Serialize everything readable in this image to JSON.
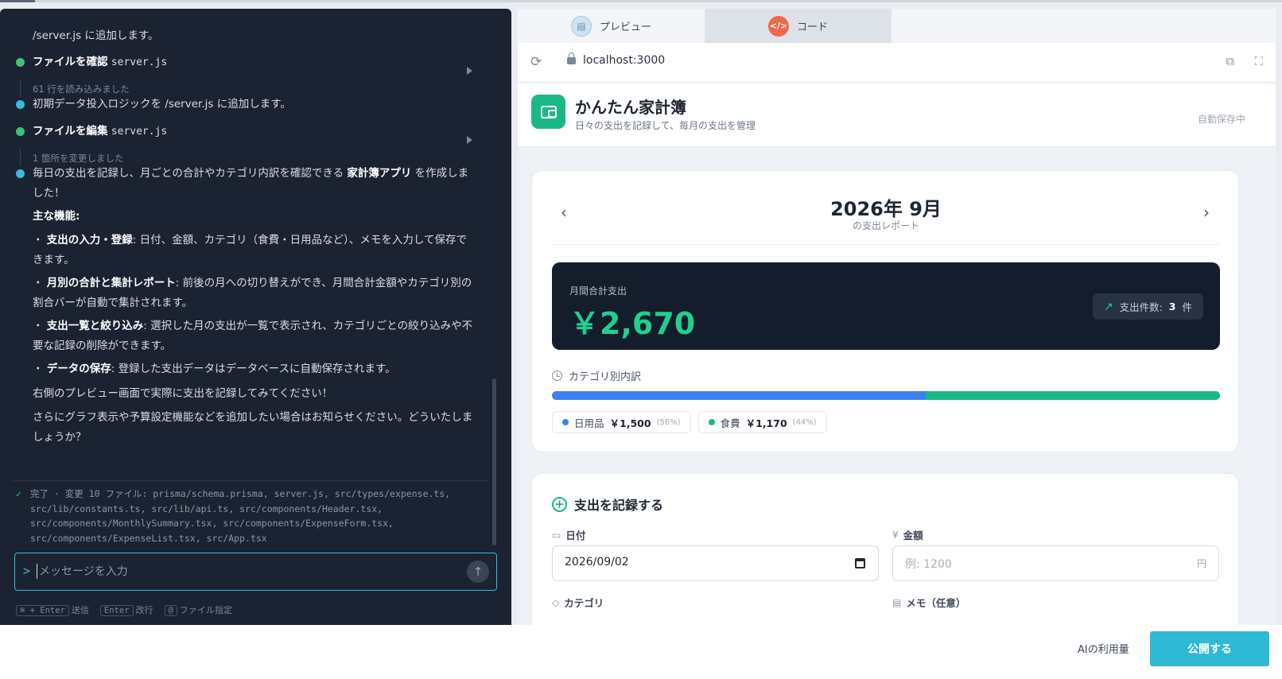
{
  "chat": {
    "top_line": "/server.js に追加します。",
    "step1": {
      "action": "ファイルを確認",
      "file": "server.js",
      "detail": "61 行を読み込みました"
    },
    "msg2": "初期データ投入ロジックを /server.js に追加します。",
    "step2": {
      "action": "ファイルを編集",
      "file": "server.js",
      "detail": "1 箇所を変更しました"
    },
    "summary_pre": "毎日の支出を記録し、月ごとの合計やカテゴリ内訳を確認できる ",
    "summary_bold": "家計簿アプリ",
    "summary_post": " を作成しました！",
    "features_heading": "主な機能:",
    "features": [
      {
        "bullet": "・",
        "title": "支出の入力・登録",
        "text": ": 日付、金額、カテゴリ（食費・日用品など）、メモを入力して保存できます。"
      },
      {
        "bullet": "・",
        "title": "月別の合計と集計レポート",
        "text": ": 前後の月への切り替えができ、月間合計金額やカテゴリ別の割合バーが自動で集計されます。"
      },
      {
        "bullet": "・",
        "title": "支出一覧と絞り込み",
        "text": ": 選択した月の支出が一覧で表示され、カテゴリごとの絞り込みや不要な記録の削除ができます。"
      },
      {
        "bullet": "・",
        "title": "データの保存",
        "text": ": 登録した支出データはデータベースに自動保存されます。"
      }
    ],
    "closing1": "右側のプレビュー画面で実際に支出を記録してみてください！",
    "closing2": "さらにグラフ表示や予算設定機能などを追加したい場合はお知らせください。どういたしましょうか？",
    "done_text": "完了 · 変更 10 ファイル: prisma/schema.prisma, server.js, src/types/expense.ts, src/lib/constants.ts, src/lib/api.ts, src/components/Header.tsx, src/components/MonthlySummary.tsx, src/components/ExpenseForm.tsx, src/components/ExpenseList.tsx, src/App.tsx",
    "input_placeholder": "メッセージを入力",
    "prompt_symbol": ">",
    "hints": [
      {
        "key": "⌘ + Enter",
        "label": "送信"
      },
      {
        "key": "Enter",
        "label": "改行"
      },
      {
        "key": "@",
        "label": "ファイル指定"
      }
    ]
  },
  "preview": {
    "tabs": [
      {
        "label": "プレビュー",
        "icon": "preview-icon"
      },
      {
        "label": "コード",
        "icon": "code-icon",
        "icon_glyph": "</>"
      }
    ],
    "url": "localhost:3000",
    "app": {
      "title": "かんたん家計簿",
      "subtitle": "日々の支出を記録して、毎月の支出を管理",
      "autosave": "自動保存中"
    },
    "report": {
      "month": "2026年 9月",
      "month_sub": "の支出レポート",
      "total_label": "月間合計支出",
      "total_value": "￥2,670",
      "count_label": "支出件数:",
      "count_value": "3",
      "count_unit": "件",
      "category_heading": "カテゴリ別内訳",
      "categories": [
        {
          "name": "日用品",
          "amount": "￥1,500",
          "pct": "(56%)",
          "share": 0.56,
          "color": "#3b82f0"
        },
        {
          "name": "食費",
          "amount": "￥1,170",
          "pct": "(44%)",
          "share": 0.44,
          "color": "#1bb887"
        }
      ]
    },
    "form": {
      "title": "支出を記録する",
      "date_label": "日付",
      "date_value": "2026/09/02",
      "amount_label": "金額",
      "amount_label_icon": "¥",
      "amount_placeholder": "例: 1200",
      "amount_unit": "円",
      "category_label": "カテゴリ",
      "memo_label": "メモ（任意）"
    }
  },
  "footer": {
    "usage_link": "AIの利用量",
    "publish_button": "公開する"
  },
  "colors": {
    "accent_green": "#1bb887",
    "accent_blue": "#3b82f0",
    "publish_cyan": "#2fb9d6",
    "chat_bg": "#1b2332"
  }
}
